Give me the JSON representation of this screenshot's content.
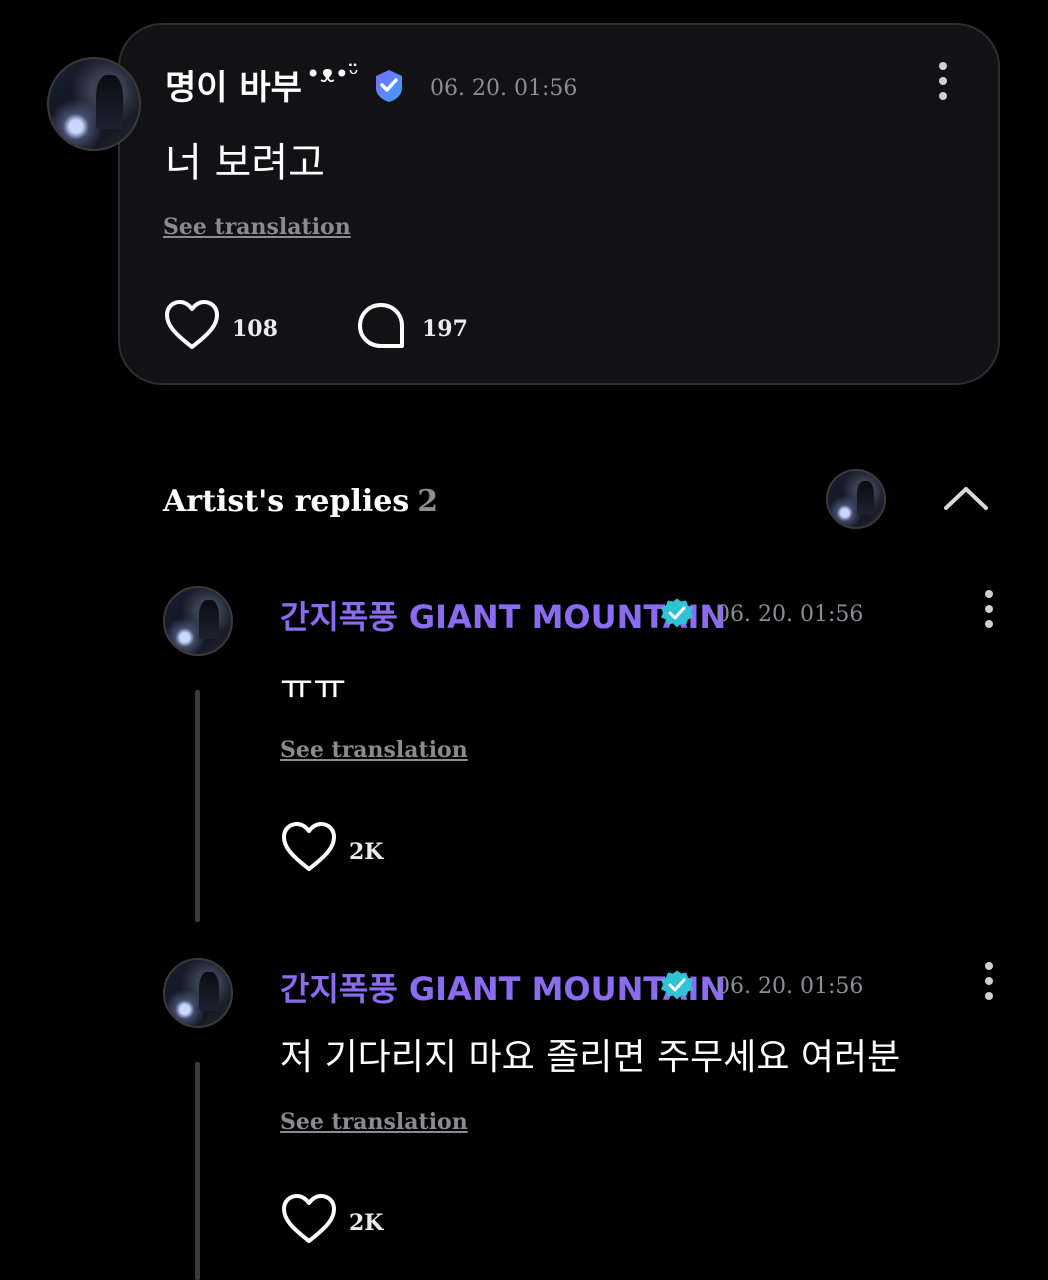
{
  "post": {
    "author": "명이 바부",
    "author_deco": "•ᴥ•ᵕ̈",
    "timestamp": "06. 20. 01:56",
    "body": "너 보려고",
    "see_translation": "See translation",
    "likes": "108",
    "comments": "197"
  },
  "replies_section": {
    "title": "Artist's replies",
    "count": "2"
  },
  "replies": [
    {
      "author": "간지폭풍 GIANT MOUNTAIN",
      "timestamp": "06. 20. 01:56",
      "body": "ㅠㅠ",
      "see_translation": "See translation",
      "likes": "2K"
    },
    {
      "author": "간지폭풍 GIANT MOUNTAIN",
      "timestamp": "06. 20. 01:56",
      "body": "저 기다리지 마요 졸리면 주무세요 여러분",
      "see_translation": "See translation",
      "likes": "2K"
    }
  ],
  "colors": {
    "background": "#000000",
    "card": "#121214",
    "artist_name": "#8b6cf0",
    "verified": "#2ec4d6",
    "membership_badge": "#5b8cff",
    "muted": "#8d8d94"
  },
  "icons": [
    "heart-icon",
    "comment-icon",
    "more-icon",
    "chevron-up-icon",
    "verified-icon",
    "membership-badge-icon"
  ]
}
